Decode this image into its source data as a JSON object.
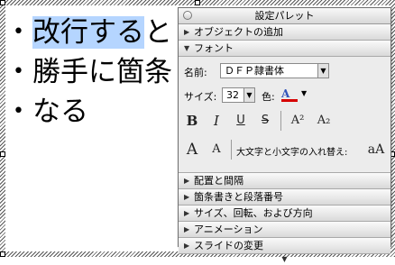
{
  "slide": {
    "bullets": [
      {
        "dot": "•",
        "selected_text": "改行する",
        "rest_text": "と"
      },
      {
        "dot": "•",
        "selected_text": "",
        "rest_text": "勝手に箇条"
      },
      {
        "dot": "•",
        "selected_text": "",
        "rest_text": "なる"
      }
    ],
    "selection_color": "#b5d5ff"
  },
  "palette": {
    "title": "設定パレット",
    "sections": {
      "object_add": "オブジェクトの追加",
      "font": "フォント",
      "alignment": "配置と間隔",
      "bullets": "箇条書きと段落番号",
      "size_rotate": "サイズ、回転、および方向",
      "animation": "アニメーション",
      "slide_change": "スライドの変更"
    },
    "font": {
      "name_label": "名前:",
      "name_value": "ＤＦＰ隷書体",
      "size_label": "サイズ:",
      "size_value": "32",
      "color_label": "色:",
      "color_value": "#d60000",
      "bold_label": "B",
      "italic_label": "I",
      "underline_label": "U",
      "shadow_label": "S",
      "superscript_label": "A²",
      "subscript_label": "A₂",
      "grow_label": "A",
      "shrink_label": "A",
      "case_label": "大文字と小文字の入れ替え:",
      "case_button": "aA"
    }
  }
}
